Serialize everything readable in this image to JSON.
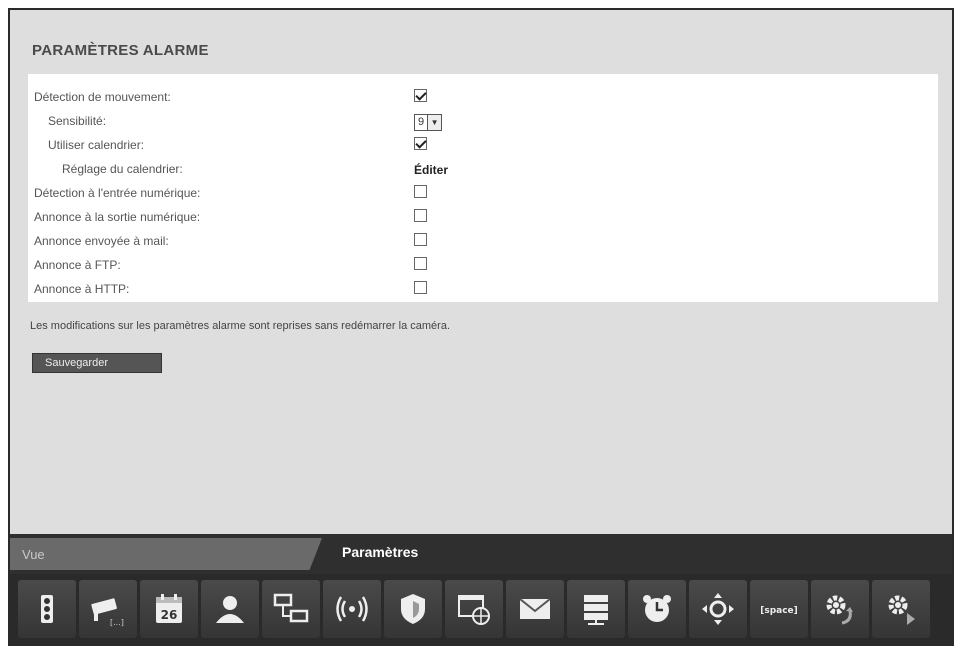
{
  "page": {
    "title": "PARAMÈTRES ALARME",
    "note": "Les modifications sur les paramètres alarme sont reprises sans redémarrer la caméra.",
    "save_label": "Sauvegarder"
  },
  "settings": [
    {
      "label": "Détection de mouvement:",
      "control": "checkbox",
      "checked": true,
      "indent": 0
    },
    {
      "label": "Sensibilité:",
      "control": "select",
      "value": "9",
      "indent": 1
    },
    {
      "label": "Utiliser calendrier:",
      "control": "checkbox",
      "checked": true,
      "indent": 1
    },
    {
      "label": "Réglage du calendrier:",
      "control": "link",
      "value": "Éditer",
      "indent": 2
    },
    {
      "label": "Détection à l'entrée numérique:",
      "control": "checkbox",
      "checked": false,
      "indent": 0
    },
    {
      "label": "Annonce à la sortie numérique:",
      "control": "checkbox",
      "checked": false,
      "indent": 0
    },
    {
      "label": "Annonce envoyée à mail:",
      "control": "checkbox",
      "checked": false,
      "indent": 0
    },
    {
      "label": "Annonce à FTP:",
      "control": "checkbox",
      "checked": false,
      "indent": 0
    },
    {
      "label": "Annonce à HTTP:",
      "control": "checkbox",
      "checked": false,
      "indent": 0
    }
  ],
  "tabs": {
    "vue": "Vue",
    "parametres": "Paramètres"
  },
  "toolbar": {
    "icons": [
      {
        "name": "traffic-light-icon"
      },
      {
        "name": "camera-settings-icon"
      },
      {
        "name": "calendar-icon",
        "text": "26"
      },
      {
        "name": "user-icon"
      },
      {
        "name": "network-icon"
      },
      {
        "name": "wireless-icon"
      },
      {
        "name": "shield-icon"
      },
      {
        "name": "web-icon"
      },
      {
        "name": "mail-icon"
      },
      {
        "name": "server-icon"
      },
      {
        "name": "alarm-clock-icon"
      },
      {
        "name": "ptz-control-icon"
      },
      {
        "name": "space-icon",
        "text": "[space]"
      },
      {
        "name": "gear-refresh-icon"
      },
      {
        "name": "gear-play-icon"
      }
    ]
  },
  "colors": {
    "frame_bg": "#dddddd",
    "panel_bg": "#ffffff",
    "tabbar_bg": "#2f2f2f",
    "tab_inactive": "#6a6a6a",
    "button_bg": "#555555"
  }
}
